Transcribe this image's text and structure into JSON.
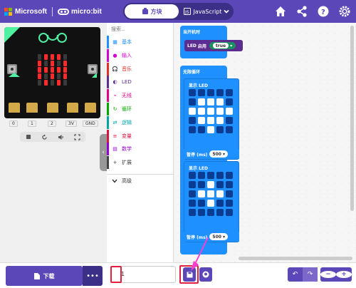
{
  "header": {
    "brand": "Microsoft",
    "product": "micro:bit",
    "mode_blocks": "方块",
    "mode_js": "JavaScript",
    "colors": {
      "bg": "#5c47b8",
      "ms_red": "#f25022",
      "ms_green": "#7fba00",
      "ms_blue": "#00a4ef",
      "ms_yellow": "#ffb900"
    }
  },
  "simulator": {
    "pins": [
      "0",
      "1",
      "2",
      "3V",
      "GND"
    ],
    "controls": [
      "stop-icon",
      "restart-icon",
      "sound-icon",
      "fullscreen-icon"
    ],
    "display_pattern": [
      [
        0,
        1,
        1,
        1,
        0
      ],
      [
        1,
        0,
        1,
        0,
        1
      ],
      [
        1,
        1,
        1,
        1,
        1
      ],
      [
        1,
        0,
        1,
        0,
        1
      ],
      [
        0,
        1,
        0,
        1,
        0
      ]
    ]
  },
  "toolbox": {
    "search_placeholder": "搜索...",
    "categories": [
      {
        "label": "基本",
        "color": "#1e90ff",
        "icon": "grid-icon"
      },
      {
        "label": "输入",
        "color": "#d400d4",
        "icon": "input-icon"
      },
      {
        "label": "音乐",
        "color": "#e63022",
        "icon": "headphones-icon"
      },
      {
        "label": "LED",
        "color": "#5c2d91",
        "icon": "toggle-icon"
      },
      {
        "label": "无线",
        "color": "#e3008c",
        "icon": "signal-icon"
      },
      {
        "label": "循环",
        "color": "#00aa00",
        "icon": "loop-icon"
      },
      {
        "label": "逻辑",
        "color": "#00a4a6",
        "icon": "shuffle-icon"
      },
      {
        "label": "变量",
        "color": "#dc143c",
        "icon": "variables-icon"
      },
      {
        "label": "数学",
        "color": "#9400d3",
        "icon": "calculator-icon"
      },
      {
        "label": "扩展",
        "color": "#444444",
        "icon": "plus-icon"
      }
    ],
    "advanced": "高级"
  },
  "workspace": {
    "on_start": "当开机时",
    "led_enable": "LED",
    "led_enable_label": "启用",
    "led_enable_value": "true",
    "forever": "无限循环",
    "show_leds": "显示 LED",
    "pause_label": "暂停 (ms)",
    "pause_value_1": "500",
    "pause_value_2": "500",
    "matrix_1": [
      [
        0,
        0,
        0,
        0,
        0
      ],
      [
        0,
        1,
        1,
        1,
        0
      ],
      [
        1,
        1,
        1,
        1,
        1
      ],
      [
        0,
        1,
        1,
        1,
        0
      ],
      [
        0,
        0,
        1,
        0,
        0
      ]
    ],
    "matrix_2": [
      [
        0,
        0,
        0,
        0,
        0
      ],
      [
        0,
        0,
        1,
        0,
        0
      ],
      [
        0,
        1,
        1,
        1,
        0
      ],
      [
        0,
        0,
        1,
        0,
        0
      ],
      [
        0,
        0,
        0,
        0,
        0
      ]
    ]
  },
  "bottom": {
    "download": "下载",
    "project_name": "1"
  }
}
